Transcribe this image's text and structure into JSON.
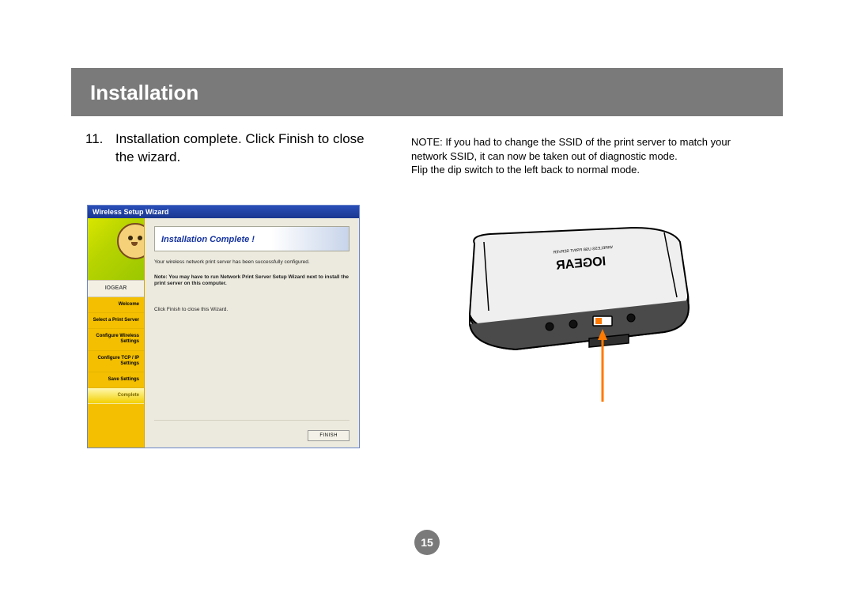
{
  "header": {
    "title": "Installation"
  },
  "step": {
    "number": "11.",
    "text": "Installation complete. Click Finish to close the wizard."
  },
  "note": {
    "line1": "NOTE: If you had to change the SSID of the print server to match your network SSID, it can now be taken out of diagnostic mode.",
    "line2": "Flip the dip switch to the left back to normal mode."
  },
  "wizard": {
    "windowTitle": "Wireless Setup Wizard",
    "brand": "IOGEAR",
    "steps": [
      "Welcome",
      "Select a Print Server",
      "Configure Wireless Settings",
      "Configure TCP / IP Settings",
      "Save Settings",
      "Complete"
    ],
    "heading": "Installation Complete !",
    "body1": "Your wireless network print server has been successfully configured.",
    "body2": "Note: You may have to run Network Print Server Setup Wizard next to install the print server on this computer.",
    "body3": "Click Finish to close this Wizard.",
    "finishLabel": "FINISH"
  },
  "device": {
    "brand": "IOGEAR"
  },
  "pageNumber": "15"
}
